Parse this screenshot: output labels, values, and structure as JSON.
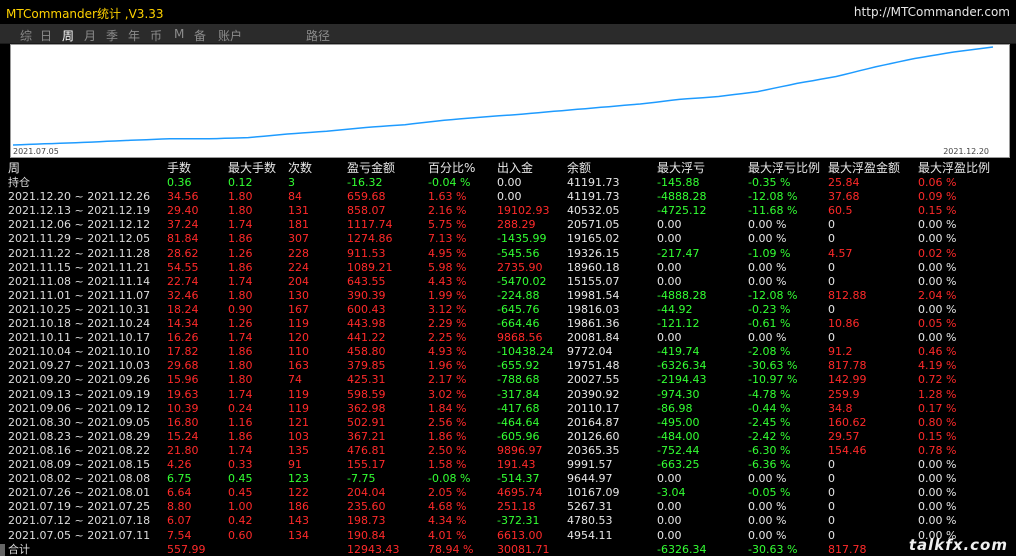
{
  "app": {
    "title": "MTCommander统计 ,V3.33",
    "site": "http://MTCommander.com"
  },
  "tabs": [
    "综",
    "日",
    "周",
    "月",
    "季",
    "年",
    "币",
    "M",
    "备",
    "账户",
    "路径"
  ],
  "active_tab": 2,
  "chart": {
    "start_label": "2021.07.05",
    "end_label": "2021.12.20",
    "line_color": "#1e9bff",
    "background": "#ffffff"
  },
  "table": {
    "headers": [
      "周",
      "手数",
      "最大手数",
      "次数",
      "盈亏金额",
      "百分比%",
      "出入金",
      "余额",
      "最大浮亏",
      "最大浮亏比例",
      "最大浮盈金额",
      "最大浮盈比例"
    ],
    "rows": [
      {
        "label": "持仓",
        "c": [
          "0.36",
          "0.12",
          "3",
          "-16.32",
          "-0.04 %",
          "0.00",
          "41191.73",
          "-145.88",
          "-0.35 %",
          "25.84",
          "0.06 %"
        ],
        "k": [
          "g",
          "g",
          "g",
          "g",
          "g",
          "w",
          "w",
          "g",
          "g",
          "r",
          "r"
        ]
      },
      {
        "label": "2021.12.20 ~ 2021.12.26",
        "c": [
          "34.56",
          "1.80",
          "84",
          "659.68",
          "1.63 %",
          "0.00",
          "41191.73",
          "-4888.28",
          "-12.08 %",
          "37.68",
          "0.09 %"
        ],
        "k": [
          "r",
          "r",
          "r",
          "r",
          "r",
          "w",
          "w",
          "g",
          "g",
          "r",
          "r"
        ]
      },
      {
        "label": "2021.12.13 ~ 2021.12.19",
        "c": [
          "29.40",
          "1.80",
          "131",
          "858.07",
          "2.16 %",
          "19102.93",
          "40532.05",
          "-4725.12",
          "-11.68 %",
          "60.5",
          "0.15 %"
        ],
        "k": [
          "r",
          "r",
          "r",
          "r",
          "r",
          "r",
          "w",
          "g",
          "g",
          "r",
          "r"
        ]
      },
      {
        "label": "2021.12.06 ~ 2021.12.12",
        "c": [
          "37.24",
          "1.74",
          "181",
          "1117.74",
          "5.75 %",
          "288.29",
          "20571.05",
          "0.00",
          "0.00 %",
          "0",
          "0.00 %"
        ],
        "k": [
          "r",
          "r",
          "r",
          "r",
          "r",
          "r",
          "w",
          "w",
          "w",
          "w",
          "w"
        ]
      },
      {
        "label": "2021.11.29 ~ 2021.12.05",
        "c": [
          "81.84",
          "1.86",
          "307",
          "1274.86",
          "7.13 %",
          "-1435.99",
          "19165.02",
          "0.00",
          "0.00 %",
          "0",
          "0.00 %"
        ],
        "k": [
          "r",
          "r",
          "r",
          "r",
          "r",
          "g",
          "w",
          "w",
          "w",
          "w",
          "w"
        ]
      },
      {
        "label": "2021.11.22 ~ 2021.11.28",
        "c": [
          "28.62",
          "1.26",
          "228",
          "911.53",
          "4.95 %",
          "-545.56",
          "19326.15",
          "-217.47",
          "-1.09 %",
          "4.57",
          "0.02 %"
        ],
        "k": [
          "r",
          "r",
          "r",
          "r",
          "r",
          "g",
          "w",
          "g",
          "g",
          "r",
          "r"
        ]
      },
      {
        "label": "2021.11.15 ~ 2021.11.21",
        "c": [
          "54.55",
          "1.86",
          "224",
          "1089.21",
          "5.98 %",
          "2735.90",
          "18960.18",
          "0.00",
          "0.00 %",
          "0",
          "0.00 %"
        ],
        "k": [
          "r",
          "r",
          "r",
          "r",
          "r",
          "r",
          "w",
          "w",
          "w",
          "w",
          "w"
        ]
      },
      {
        "label": "2021.11.08 ~ 2021.11.14",
        "c": [
          "22.74",
          "1.74",
          "204",
          "643.55",
          "4.43 %",
          "-5470.02",
          "15155.07",
          "0.00",
          "0.00 %",
          "0",
          "0.00 %"
        ],
        "k": [
          "r",
          "r",
          "r",
          "r",
          "r",
          "g",
          "w",
          "w",
          "w",
          "w",
          "w"
        ]
      },
      {
        "label": "2021.11.01 ~ 2021.11.07",
        "c": [
          "32.46",
          "1.80",
          "130",
          "390.39",
          "1.99 %",
          "-224.88",
          "19981.54",
          "-4888.28",
          "-12.08 %",
          "812.88",
          "2.04 %"
        ],
        "k": [
          "r",
          "r",
          "r",
          "r",
          "r",
          "g",
          "w",
          "g",
          "g",
          "r",
          "r"
        ]
      },
      {
        "label": "2021.10.25 ~ 2021.10.31",
        "c": [
          "18.24",
          "0.90",
          "167",
          "600.43",
          "3.12 %",
          "-645.76",
          "19816.03",
          "-44.92",
          "-0.23 %",
          "0",
          "0.00 %"
        ],
        "k": [
          "r",
          "r",
          "r",
          "r",
          "r",
          "g",
          "w",
          "g",
          "g",
          "w",
          "w"
        ]
      },
      {
        "label": "2021.10.18 ~ 2021.10.24",
        "c": [
          "14.34",
          "1.26",
          "119",
          "443.98",
          "2.29 %",
          "-664.46",
          "19861.36",
          "-121.12",
          "-0.61 %",
          "10.86",
          "0.05 %"
        ],
        "k": [
          "r",
          "r",
          "r",
          "r",
          "r",
          "g",
          "w",
          "g",
          "g",
          "r",
          "r"
        ]
      },
      {
        "label": "2021.10.11 ~ 2021.10.17",
        "c": [
          "16.26",
          "1.74",
          "120",
          "441.22",
          "2.25 %",
          "9868.56",
          "20081.84",
          "0.00",
          "0.00 %",
          "0",
          "0.00 %"
        ],
        "k": [
          "r",
          "r",
          "r",
          "r",
          "r",
          "r",
          "w",
          "w",
          "w",
          "w",
          "w"
        ]
      },
      {
        "label": "2021.10.04 ~ 2021.10.10",
        "c": [
          "17.82",
          "1.86",
          "110",
          "458.80",
          "4.93 %",
          "-10438.24",
          "9772.04",
          "-419.74",
          "-2.08 %",
          "91.2",
          "0.46 %"
        ],
        "k": [
          "r",
          "r",
          "r",
          "r",
          "r",
          "g",
          "w",
          "g",
          "g",
          "r",
          "r"
        ]
      },
      {
        "label": "2021.09.27 ~ 2021.10.03",
        "c": [
          "29.68",
          "1.80",
          "163",
          "379.85",
          "1.96 %",
          "-655.92",
          "19751.48",
          "-6326.34",
          "-30.63 %",
          "817.78",
          "4.19 %"
        ],
        "k": [
          "r",
          "r",
          "r",
          "r",
          "r",
          "g",
          "w",
          "g",
          "g",
          "r",
          "r"
        ]
      },
      {
        "label": "2021.09.20 ~ 2021.09.26",
        "c": [
          "15.96",
          "1.80",
          "74",
          "425.31",
          "2.17 %",
          "-788.68",
          "20027.55",
          "-2194.43",
          "-10.97 %",
          "142.99",
          "0.72 %"
        ],
        "k": [
          "r",
          "r",
          "r",
          "r",
          "r",
          "g",
          "w",
          "g",
          "g",
          "r",
          "r"
        ]
      },
      {
        "label": "2021.09.13 ~ 2021.09.19",
        "c": [
          "19.63",
          "1.74",
          "119",
          "598.59",
          "3.02 %",
          "-317.84",
          "20390.92",
          "-974.30",
          "-4.78 %",
          "259.9",
          "1.28 %"
        ],
        "k": [
          "r",
          "r",
          "r",
          "r",
          "r",
          "g",
          "w",
          "g",
          "g",
          "r",
          "r"
        ]
      },
      {
        "label": "2021.09.06 ~ 2021.09.12",
        "c": [
          "10.39",
          "0.24",
          "119",
          "362.98",
          "1.84 %",
          "-417.68",
          "20110.17",
          "-86.98",
          "-0.44 %",
          "34.8",
          "0.17 %"
        ],
        "k": [
          "r",
          "r",
          "r",
          "r",
          "r",
          "g",
          "w",
          "g",
          "g",
          "r",
          "r"
        ]
      },
      {
        "label": "2021.08.30 ~ 2021.09.05",
        "c": [
          "16.80",
          "1.16",
          "121",
          "502.91",
          "2.56 %",
          "-464.64",
          "20164.87",
          "-495.00",
          "-2.45 %",
          "160.62",
          "0.80 %"
        ],
        "k": [
          "r",
          "r",
          "r",
          "r",
          "r",
          "g",
          "w",
          "g",
          "g",
          "r",
          "r"
        ]
      },
      {
        "label": "2021.08.23 ~ 2021.08.29",
        "c": [
          "15.24",
          "1.86",
          "103",
          "367.21",
          "1.86 %",
          "-605.96",
          "20126.60",
          "-484.00",
          "-2.42 %",
          "29.57",
          "0.15 %"
        ],
        "k": [
          "r",
          "r",
          "r",
          "r",
          "r",
          "g",
          "w",
          "g",
          "g",
          "r",
          "r"
        ]
      },
      {
        "label": "2021.08.16 ~ 2021.08.22",
        "c": [
          "21.80",
          "1.74",
          "135",
          "476.81",
          "2.50 %",
          "9896.97",
          "20365.35",
          "-752.44",
          "-6.30 %",
          "154.46",
          "0.78 %"
        ],
        "k": [
          "r",
          "r",
          "r",
          "r",
          "r",
          "r",
          "w",
          "g",
          "g",
          "r",
          "r"
        ]
      },
      {
        "label": "2021.08.09 ~ 2021.08.15",
        "c": [
          "4.26",
          "0.33",
          "91",
          "155.17",
          "1.58 %",
          "191.43",
          "9991.57",
          "-663.25",
          "-6.36 %",
          "0",
          "0.00 %"
        ],
        "k": [
          "r",
          "r",
          "r",
          "r",
          "r",
          "r",
          "w",
          "g",
          "g",
          "w",
          "w"
        ]
      },
      {
        "label": "2021.08.02 ~ 2021.08.08",
        "c": [
          "6.75",
          "0.45",
          "123",
          "-7.75",
          "-0.08 %",
          "-514.37",
          "9644.97",
          "0.00",
          "0.00 %",
          "0",
          "0.00 %"
        ],
        "k": [
          "g",
          "g",
          "g",
          "g",
          "g",
          "g",
          "w",
          "w",
          "w",
          "w",
          "w"
        ]
      },
      {
        "label": "2021.07.26 ~ 2021.08.01",
        "c": [
          "6.64",
          "0.45",
          "122",
          "204.04",
          "2.05 %",
          "4695.74",
          "10167.09",
          "-3.04",
          "-0.05 %",
          "0",
          "0.00 %"
        ],
        "k": [
          "r",
          "r",
          "r",
          "r",
          "r",
          "r",
          "w",
          "g",
          "g",
          "w",
          "w"
        ]
      },
      {
        "label": "2021.07.19 ~ 2021.07.25",
        "c": [
          "8.80",
          "1.00",
          "186",
          "235.60",
          "4.68 %",
          "251.18",
          "5267.31",
          "0.00",
          "0.00 %",
          "0",
          "0.00 %"
        ],
        "k": [
          "r",
          "r",
          "r",
          "r",
          "r",
          "r",
          "w",
          "w",
          "w",
          "w",
          "w"
        ]
      },
      {
        "label": "2021.07.12 ~ 2021.07.18",
        "c": [
          "6.07",
          "0.42",
          "143",
          "198.73",
          "4.34 %",
          "-372.31",
          "4780.53",
          "0.00",
          "0.00 %",
          "0",
          "0.00 %"
        ],
        "k": [
          "r",
          "r",
          "r",
          "r",
          "r",
          "g",
          "w",
          "w",
          "w",
          "w",
          "w"
        ]
      },
      {
        "label": "2021.07.05 ~ 2021.07.11",
        "c": [
          "7.54",
          "0.60",
          "134",
          "190.84",
          "4.01 %",
          "6613.00",
          "4954.11",
          "0.00",
          "0.00 %",
          "0",
          "0.00 %"
        ],
        "k": [
          "r",
          "r",
          "r",
          "r",
          "r",
          "r",
          "w",
          "w",
          "w",
          "w",
          "w"
        ]
      },
      {
        "label": "合计",
        "c": [
          "557.99",
          "",
          "",
          "12943.43",
          "78.94 %",
          "30081.71",
          "",
          "-6326.34",
          "-30.63 %",
          "817.78",
          ""
        ],
        "k": [
          "r",
          "r",
          "r",
          "r",
          "r",
          "r",
          "w",
          "g",
          "g",
          "r",
          "r"
        ]
      }
    ]
  },
  "watermark": "talkfx.com"
}
